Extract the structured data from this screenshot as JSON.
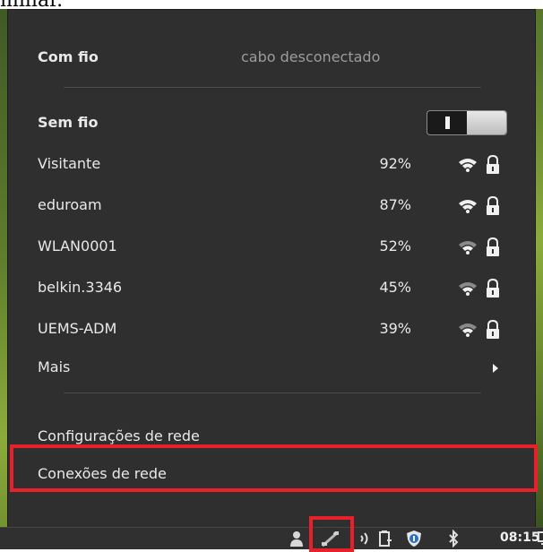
{
  "wired": {
    "label": "Com fio",
    "status": "cabo desconectado"
  },
  "wireless": {
    "label": "Sem fio",
    "toggle": "on"
  },
  "networks": [
    {
      "ssid": "Visitante",
      "signal": "92%",
      "signal_level": 4,
      "secured": true
    },
    {
      "ssid": "eduroam",
      "signal": "87%",
      "signal_level": 4,
      "secured": true
    },
    {
      "ssid": "WLAN0001",
      "signal": "52%",
      "signal_level": 3,
      "secured": true
    },
    {
      "ssid": "belkin.3346",
      "signal": "45%",
      "signal_level": 3,
      "secured": true
    },
    {
      "ssid": "UEMS-ADM",
      "signal": "39%",
      "signal_level": 3,
      "secured": true
    }
  ],
  "more": {
    "label": "Mais"
  },
  "actions": {
    "settings_label": "Configurações de rede",
    "connections_label": "Conexões de rede"
  },
  "taskbar": {
    "clock": "08:15",
    "icons": [
      "user-icon",
      "network-icon",
      "volume-icon",
      "battery-icon",
      "shield-icon",
      "bluetooth-icon",
      "display-icon"
    ]
  },
  "colors": {
    "menu_bg": "#2f2f2f",
    "highlight": "#e8202a",
    "text": "#e9e9e9",
    "muted": "#9c9c9c"
  }
}
